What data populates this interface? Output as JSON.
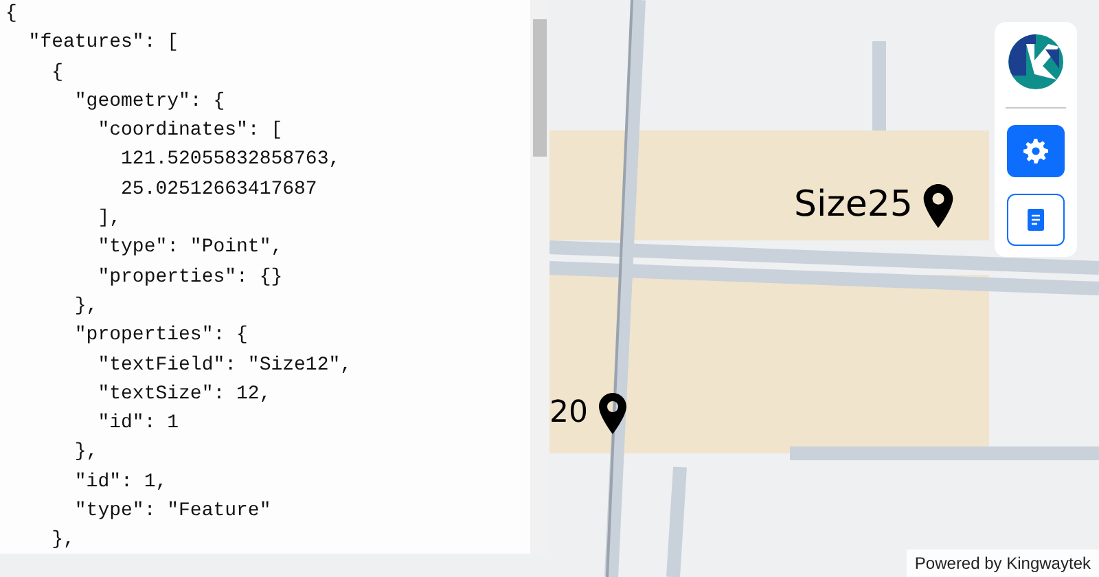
{
  "editor": {
    "lines": [
      "{",
      "  \"features\": [",
      "    {",
      "      \"geometry\": {",
      "        \"coordinates\": [",
      "          121.52055832858763,",
      "          25.02512663417687",
      "        ],",
      "        \"type\": \"Point\",",
      "        \"properties\": {}",
      "      },",
      "      \"properties\": {",
      "        \"textField\": \"Size12\",",
      "        \"textSize\": 12,",
      "        \"id\": 1",
      "      },",
      "      \"id\": 1,",
      "      \"type\": \"Feature\"",
      "    },"
    ]
  },
  "markers": [
    {
      "label": "Size25",
      "kind": "large"
    },
    {
      "label": "20",
      "kind": "cut"
    }
  ],
  "attribution": "Powered by Kingwaytek"
}
